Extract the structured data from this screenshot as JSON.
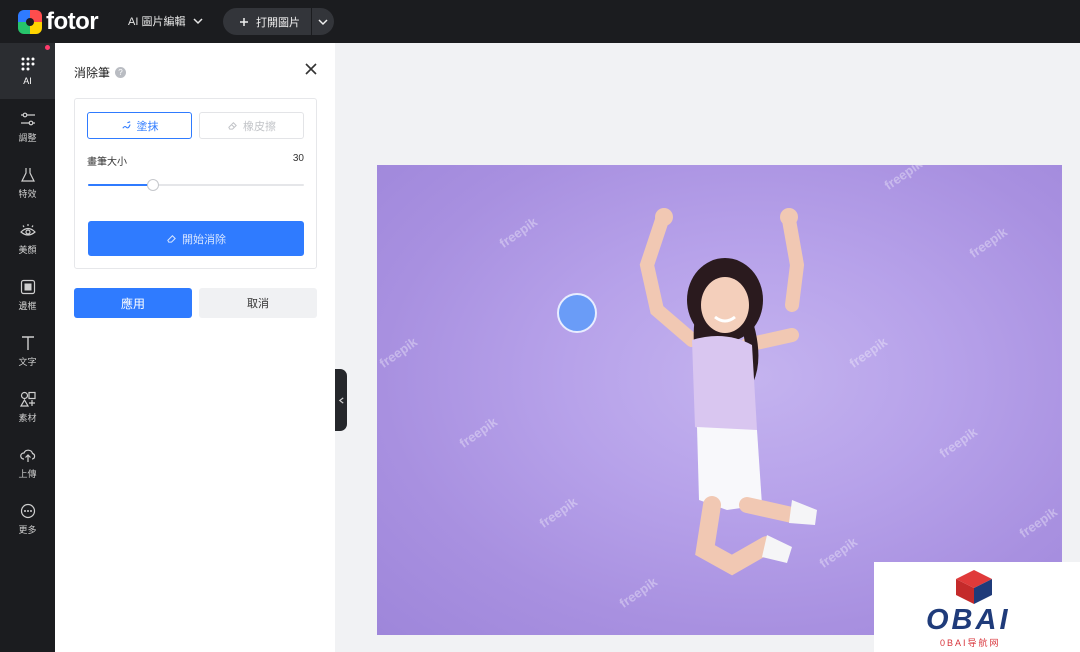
{
  "topbar": {
    "logo_text": "fotor",
    "menu_label": "AI 圖片編輯",
    "open_label": "打開圖片"
  },
  "sidebar": {
    "items": [
      {
        "label": "AI",
        "icon": "ai-grid-icon"
      },
      {
        "label": "調整",
        "icon": "sliders-icon"
      },
      {
        "label": "特效",
        "icon": "flask-icon"
      },
      {
        "label": "美顏",
        "icon": "eye-icon"
      },
      {
        "label": "邊框",
        "icon": "frame-icon"
      },
      {
        "label": "文字",
        "icon": "text-icon"
      },
      {
        "label": "素材",
        "icon": "shapes-icon"
      },
      {
        "label": "上傳",
        "icon": "upload-cloud-icon"
      },
      {
        "label": "更多",
        "icon": "more-icon"
      }
    ]
  },
  "panel": {
    "title": "消除筆",
    "mode_paint": "塗抹",
    "mode_erase": "橡皮擦",
    "brush_size_label": "畫筆大小",
    "brush_size_value": "30",
    "brush_size_fraction": 0.3,
    "start_label": "開始消除",
    "apply_label": "應用",
    "cancel_label": "取消"
  },
  "image": {
    "watermark": "freepik"
  },
  "promo": {
    "name": "OBAI",
    "subtitle": "0BAI导航网"
  },
  "colors": {
    "accent": "#2f7bff",
    "background_purple": "#b7a2ea",
    "topbar": "#1b1c1f"
  }
}
